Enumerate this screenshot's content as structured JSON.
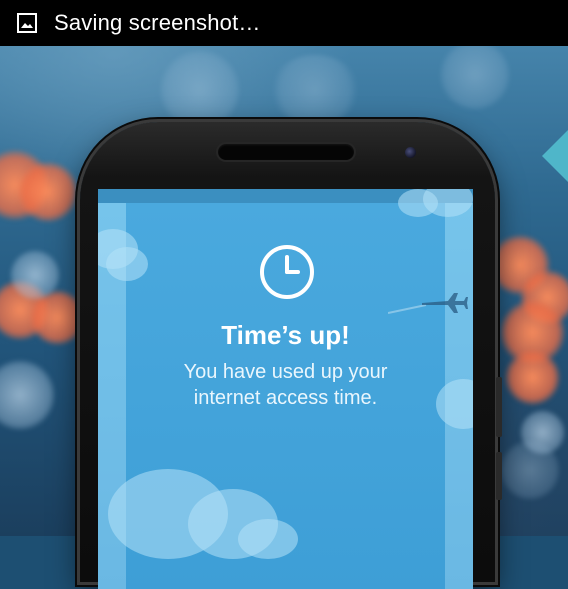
{
  "status_bar": {
    "icon": "image-icon",
    "text": "Saving screenshot…"
  },
  "screen": {
    "icon": "clock-icon",
    "title": "Time’s up!",
    "message_line1": "You have used up your",
    "message_line2": "internet access time.",
    "decoration_icon": "airplane-icon"
  },
  "colors": {
    "status_bar_bg": "#000000",
    "screen_blue": "#4aa9de",
    "text_white": "#ffffff"
  }
}
